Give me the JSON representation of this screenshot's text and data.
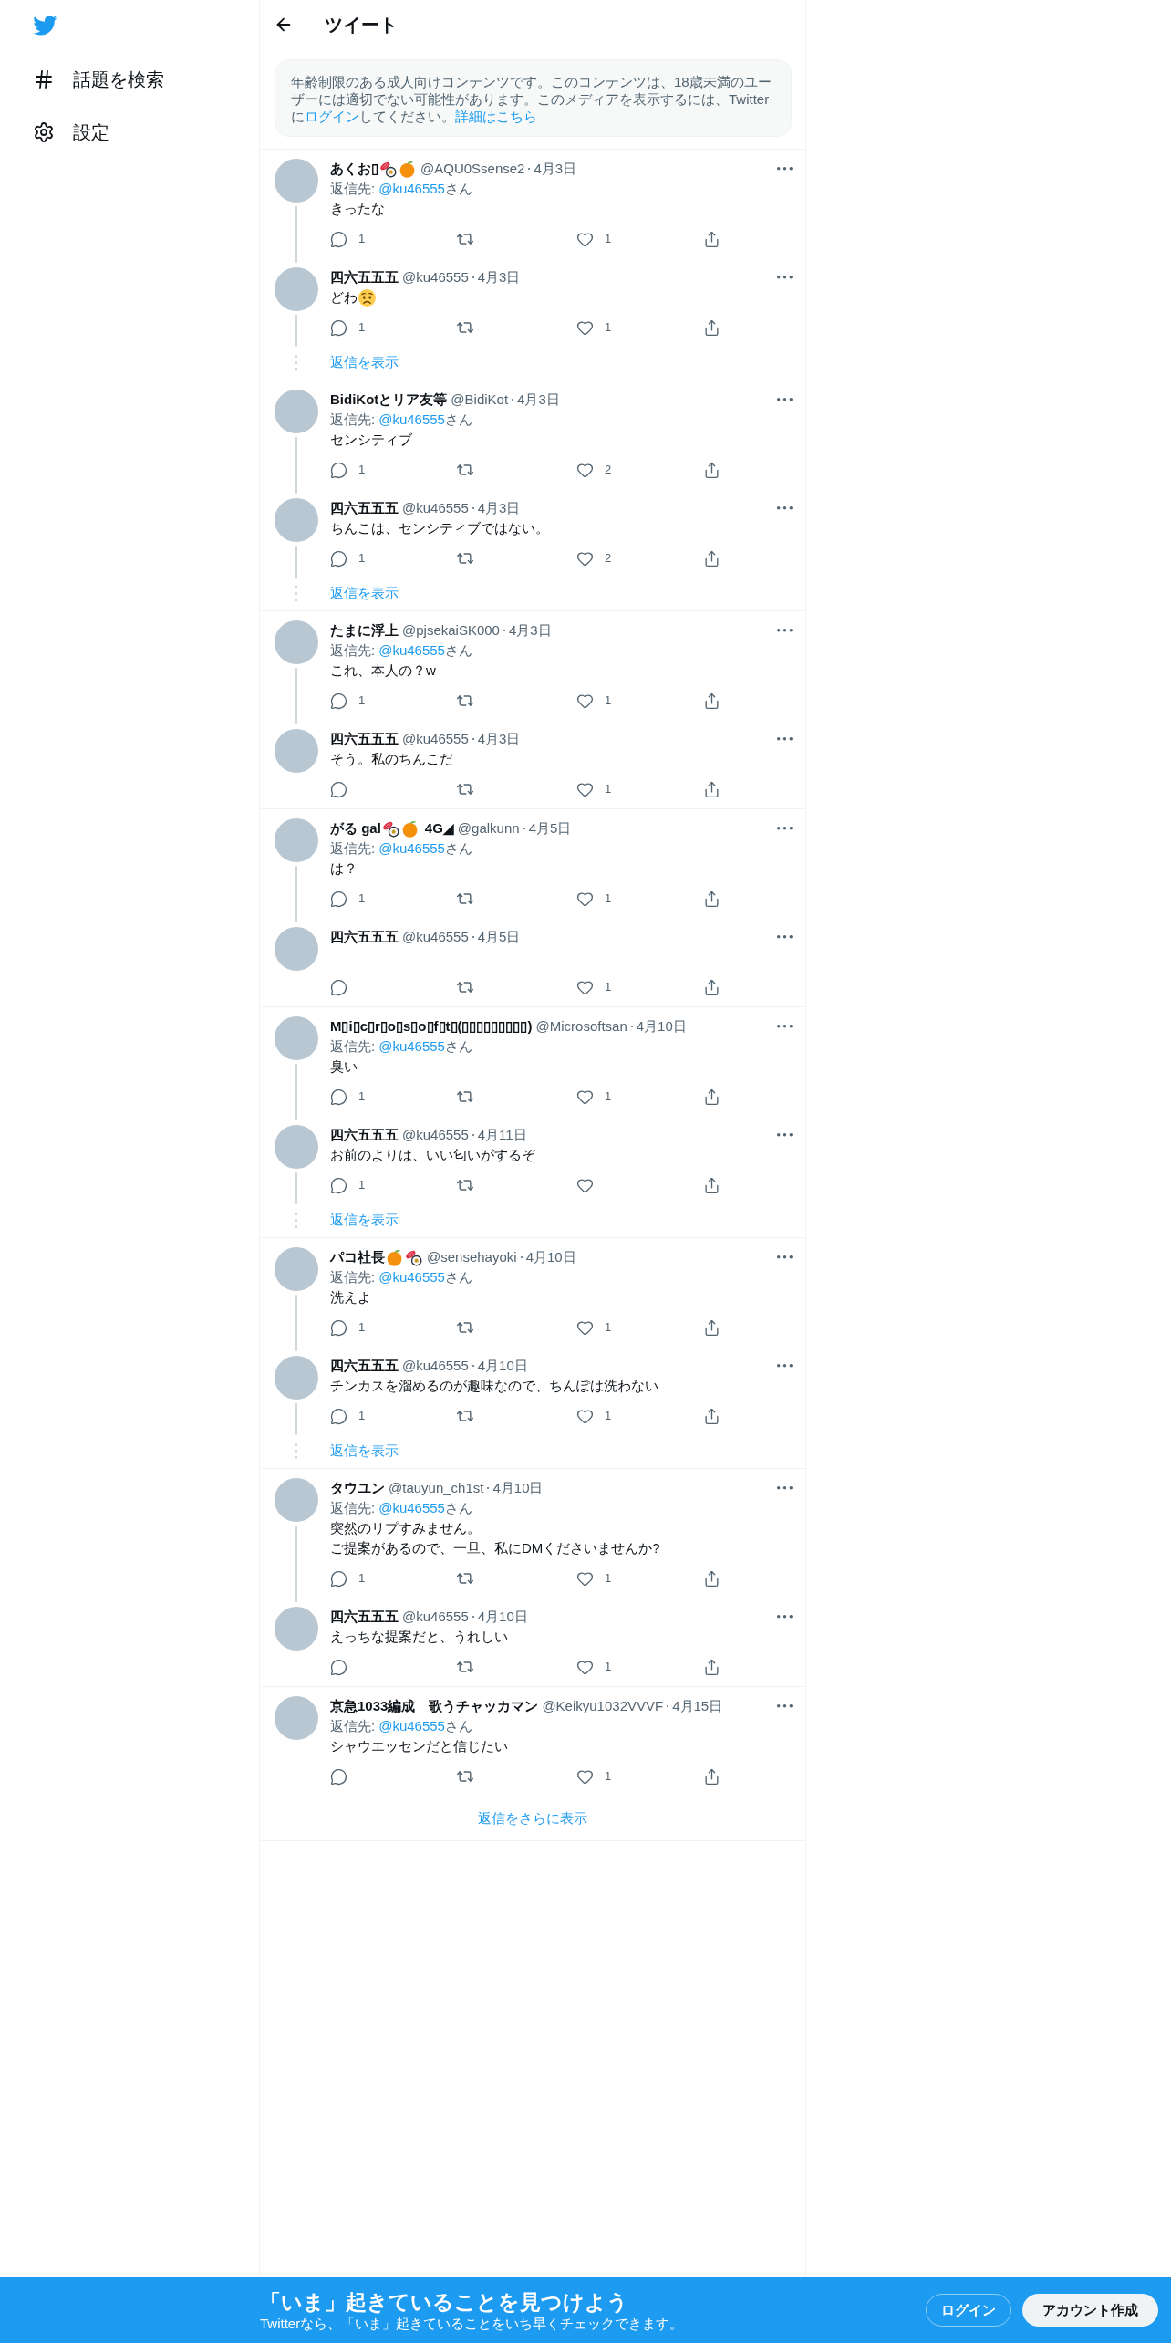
{
  "sidebar": {
    "items": [
      {
        "kind": "explore",
        "label": "話題を検索"
      },
      {
        "kind": "settings",
        "label": "設定"
      }
    ]
  },
  "header": {
    "title": "ツイート"
  },
  "notice": {
    "parts": [
      {
        "kind": "text",
        "text": "年齢制限のある成人向けコンテンツです。このコンテンツは、18歳未満のユーザーには適切でない可能性があります。このメディアを表示するには、Twitterに"
      },
      {
        "kind": "link",
        "text": "ログイン"
      },
      {
        "kind": "text",
        "text": "してください。"
      },
      {
        "kind": "link",
        "text": "詳細はこちら"
      }
    ]
  },
  "threads": [
    {
      "tweets": [
        {
          "name": [
            {
              "kind": "text",
              "text": "あくお▯"
            },
            {
              "kind": "sushi"
            },
            {
              "kind": "tangerine"
            }
          ],
          "handle": "@AQU0Ssense2",
          "date": "4月3日",
          "reply_to": {
            "label": "返信先:",
            "mention": "@ku46555",
            "suffix": "さん"
          },
          "body": "きったな",
          "replies": "1",
          "likes": "1"
        },
        {
          "name": "四六五五五",
          "handle": "@ku46555",
          "date": "4月3日",
          "body": [
            {
              "kind": "text",
              "text": "どわ"
            },
            {
              "kind": "worried"
            }
          ],
          "replies": "1",
          "likes": "1"
        }
      ],
      "show_replies": "返信を表示"
    },
    {
      "tweets": [
        {
          "name": "BidiKotとリア友等",
          "handle": "@BidiKot",
          "date": "4月3日",
          "reply_to": {
            "label": "返信先:",
            "mention": "@ku46555",
            "suffix": "さん"
          },
          "body": "センシティブ",
          "replies": "1",
          "likes": "2"
        },
        {
          "name": "四六五五五",
          "handle": "@ku46555",
          "date": "4月3日",
          "body": "ちんこは、センシティブではない。",
          "replies": "1",
          "likes": "2"
        }
      ],
      "show_replies": "返信を表示"
    },
    {
      "tweets": [
        {
          "name": "たまに浮上",
          "handle": "@pjsekaiSK000",
          "date": "4月3日",
          "reply_to": {
            "label": "返信先:",
            "mention": "@ku46555",
            "suffix": "さん"
          },
          "body": "これ、本人の？w",
          "replies": "1",
          "likes": "1"
        },
        {
          "name": "四六五五五",
          "handle": "@ku46555",
          "date": "4月3日",
          "body": "そう。私のちんこだ",
          "likes": "1"
        }
      ]
    },
    {
      "tweets": [
        {
          "name": [
            {
              "kind": "text",
              "text": "がる gal"
            },
            {
              "kind": "sushi"
            },
            {
              "kind": "tangerine"
            },
            {
              "kind": "text",
              "text": "4G◢"
            }
          ],
          "handle": "@galkunn",
          "date": "4月5日",
          "reply_to": {
            "label": "返信先:",
            "mention": "@ku46555",
            "suffix": "さん"
          },
          "body": "は？",
          "replies": "1",
          "likes": "1"
        },
        {
          "name": "四六五五五",
          "handle": "@ku46555",
          "date": "4月5日",
          "likes": "1"
        }
      ]
    },
    {
      "tweets": [
        {
          "name": "M▯i▯c▯r▯o▯s▯o▯f▯t▯(▯▯▯▯▯▯▯▯▯)",
          "handle": "@Microsoftsan",
          "date": "4月10日",
          "reply_to": {
            "label": "返信先:",
            "mention": "@ku46555",
            "suffix": "さん"
          },
          "body": "臭い",
          "replies": "1",
          "likes": "1"
        },
        {
          "name": "四六五五五",
          "handle": "@ku46555",
          "date": "4月11日",
          "body": "お前のよりは、いい匂いがするぞ",
          "replies": "1"
        }
      ],
      "show_replies": "返信を表示"
    },
    {
      "tweets": [
        {
          "name": [
            {
              "kind": "text",
              "text": "パコ社長"
            },
            {
              "kind": "tangerine"
            },
            {
              "kind": "sushi"
            }
          ],
          "handle": "@sensehayoki",
          "date": "4月10日",
          "reply_to": {
            "label": "返信先:",
            "mention": "@ku46555",
            "suffix": "さん"
          },
          "body": "洗えよ",
          "replies": "1",
          "likes": "1"
        },
        {
          "name": "四六五五五",
          "handle": "@ku46555",
          "date": "4月10日",
          "body": "チンカスを溜めるのが趣味なので、ちんぽは洗わない",
          "replies": "1",
          "likes": "1"
        }
      ],
      "show_replies": "返信を表示"
    },
    {
      "tweets": [
        {
          "name": "タウユン",
          "handle": "@tauyun_ch1st",
          "date": "4月10日",
          "reply_to": {
            "label": "返信先:",
            "mention": "@ku46555",
            "suffix": "さん"
          },
          "body_lines": [
            "突然のリプすみません。",
            "ご提案があるので、一旦、私にDMくださいませんか?"
          ],
          "replies": "1",
          "likes": "1"
        },
        {
          "name": "四六五五五",
          "handle": "@ku46555",
          "date": "4月10日",
          "body": "えっちな提案だと、うれしい",
          "likes": "1"
        }
      ]
    },
    {
      "tweets": [
        {
          "name": "京急1033編成　歌うチャッカマン",
          "handle": "@Keikyu1032VVVF",
          "date": "4月15日",
          "reply_to": {
            "label": "返信先:",
            "mention": "@ku46555",
            "suffix": "さん"
          },
          "body": "シャウエッセンだと信じたい",
          "likes": "1"
        }
      ]
    }
  ],
  "show_more": "返信をさらに表示",
  "banner": {
    "title": "「いま」起きていることを見つけよう",
    "subtitle": "Twitterなら、「いま」起きていることをいち早くチェックできます。",
    "login": "ログイン",
    "signup": "アカウント作成"
  }
}
